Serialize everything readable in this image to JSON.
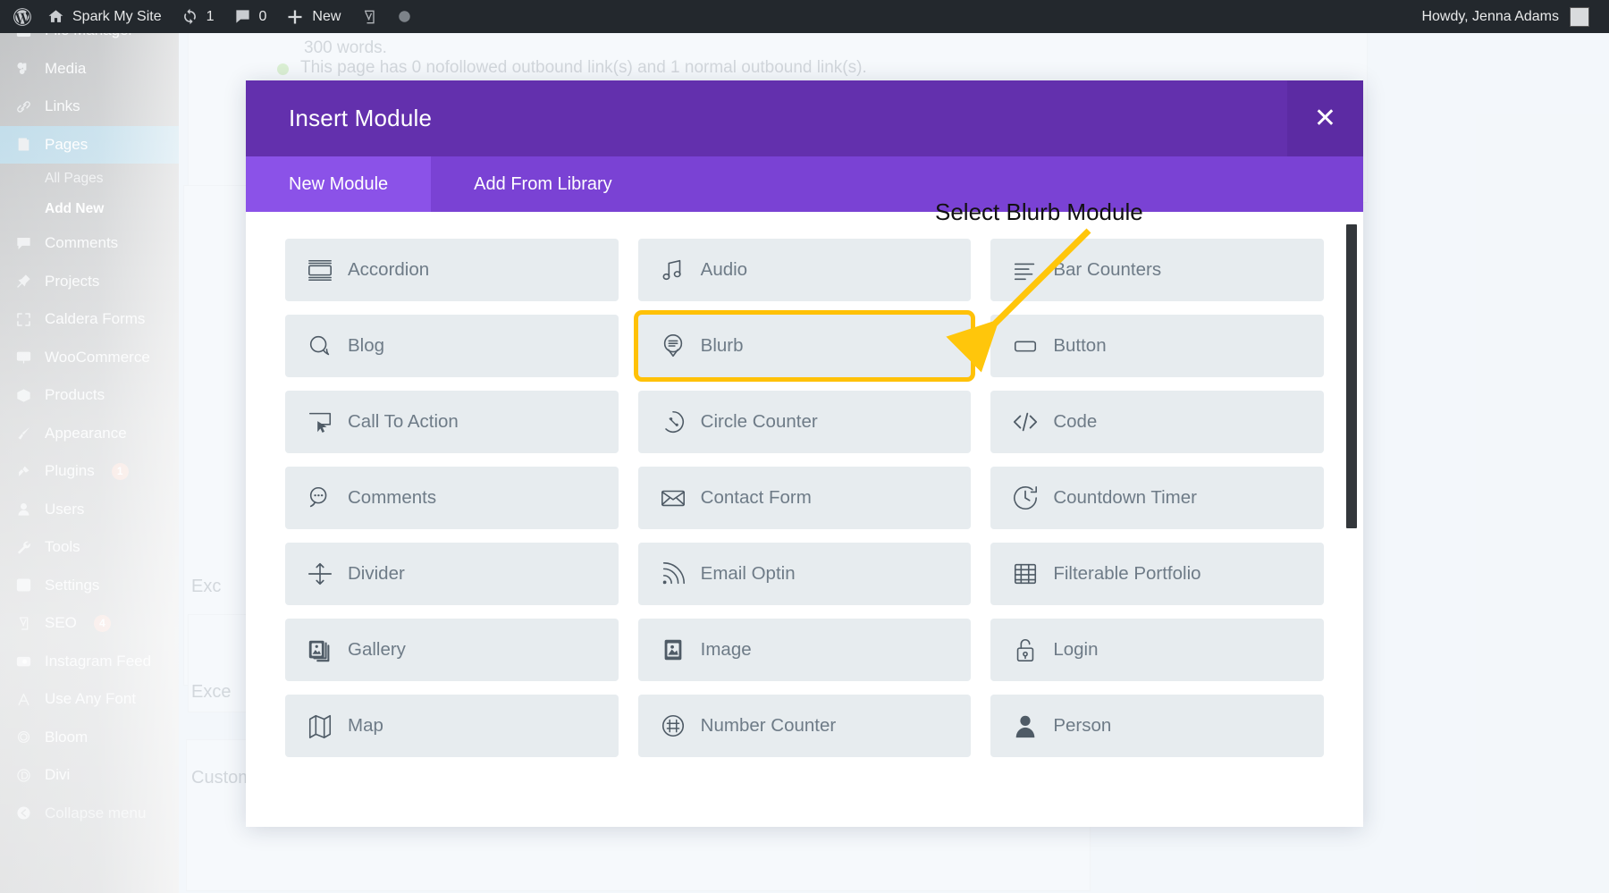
{
  "adminbar": {
    "logo_icon": "wordpress-logo-icon",
    "site_icon": "home-icon",
    "site_name": "Spark My Site",
    "updates_icon": "updates-icon",
    "updates_count": "1",
    "comments_icon": "comment-bubble-icon",
    "comments_count": "0",
    "new_icon": "plus-icon",
    "new_label": "New",
    "yoast_icon": "yoast-seo-icon",
    "status_icon": "gray-circle-icon",
    "howdy": "Howdy, Jenna Adams",
    "avatar_name": "avatar"
  },
  "sidebar": {
    "items": [
      {
        "label": "File Manager",
        "icon": "file-manager-icon",
        "state": "partial"
      },
      {
        "label": "Media",
        "icon": "media-icon",
        "state": "normal"
      },
      {
        "label": "Links",
        "icon": "links-icon",
        "state": "normal"
      },
      {
        "label": "Pages",
        "icon": "pages-icon",
        "state": "current"
      },
      {
        "label": "Comments",
        "icon": "comments-icon",
        "state": "normal"
      },
      {
        "label": "Projects",
        "icon": "projects-pin-icon",
        "state": "normal"
      },
      {
        "label": "Caldera Forms",
        "icon": "caldera-forms-icon",
        "state": "normal"
      },
      {
        "label": "WooCommerce",
        "icon": "woocommerce-icon",
        "state": "normal"
      },
      {
        "label": "Products",
        "icon": "products-box-icon",
        "state": "normal"
      },
      {
        "label": "Appearance",
        "icon": "appearance-brush-icon",
        "state": "normal"
      },
      {
        "label": "Plugins",
        "icon": "plugins-icon",
        "state": "normal",
        "badge": "1"
      },
      {
        "label": "Users",
        "icon": "users-icon",
        "state": "normal"
      },
      {
        "label": "Tools",
        "icon": "tools-wrench-icon",
        "state": "normal"
      },
      {
        "label": "Settings",
        "icon": "settings-icon",
        "state": "normal"
      },
      {
        "label": "SEO",
        "icon": "yoast-seo-icon",
        "state": "normal",
        "badge": "4"
      },
      {
        "label": "Instagram Feed",
        "icon": "instagram-camera-icon",
        "state": "normal"
      },
      {
        "label": "Use Any Font",
        "icon": "letter-a-icon",
        "state": "normal"
      },
      {
        "label": "Bloom",
        "icon": "bloom-icon",
        "state": "normal"
      },
      {
        "label": "Divi",
        "icon": "divi-icon",
        "state": "normal"
      },
      {
        "label": "Collapse menu",
        "icon": "collapse-arrow-icon",
        "state": "collapse"
      }
    ],
    "submenu": [
      {
        "label": "All Pages",
        "active": false
      },
      {
        "label": "Add New",
        "active": true
      }
    ]
  },
  "background": {
    "word_count_text": "300 words.",
    "outbound_links_text": "This page has 0 nofollowed outbound link(s) and 1 normal outbound link(s).",
    "excerpt_label_1": "Exc",
    "excerpt_label_2": "Exce",
    "custom_fields_label": "Custom Fields"
  },
  "modal": {
    "title": "Insert Module",
    "close_icon": "close-x-icon",
    "close_label": "✕",
    "tabs": [
      {
        "label": "New Module",
        "active": true
      },
      {
        "label": "Add From Library",
        "active": false
      }
    ],
    "modules": [
      {
        "label": "Accordion",
        "icon": "accordion-icon",
        "highlight": false
      },
      {
        "label": "Audio",
        "icon": "audio-note-icon",
        "highlight": false
      },
      {
        "label": "Bar Counters",
        "icon": "bar-counters-icon",
        "highlight": false
      },
      {
        "label": "Blog",
        "icon": "blog-bubble-icon",
        "highlight": false
      },
      {
        "label": "Blurb",
        "icon": "blurb-icon",
        "highlight": true
      },
      {
        "label": "Button",
        "icon": "button-icon",
        "highlight": false
      },
      {
        "label": "Call To Action",
        "icon": "call-to-action-icon",
        "highlight": false
      },
      {
        "label": "Circle Counter",
        "icon": "circle-counter-icon",
        "highlight": false
      },
      {
        "label": "Code",
        "icon": "code-brackets-icon",
        "highlight": false
      },
      {
        "label": "Comments",
        "icon": "comments-bubble-icon",
        "highlight": false
      },
      {
        "label": "Contact Form",
        "icon": "envelope-icon",
        "highlight": false
      },
      {
        "label": "Countdown Timer",
        "icon": "countdown-clock-icon",
        "highlight": false
      },
      {
        "label": "Divider",
        "icon": "divider-icon",
        "highlight": false
      },
      {
        "label": "Email Optin",
        "icon": "email-optin-signal-icon",
        "highlight": false
      },
      {
        "label": "Filterable Portfolio",
        "icon": "grid-portfolio-icon",
        "highlight": false
      },
      {
        "label": "Gallery",
        "icon": "gallery-images-icon",
        "highlight": false
      },
      {
        "label": "Image",
        "icon": "image-icon",
        "highlight": false
      },
      {
        "label": "Login",
        "icon": "lock-icon",
        "highlight": false
      },
      {
        "label": "Map",
        "icon": "map-icon",
        "highlight": false
      },
      {
        "label": "Number Counter",
        "icon": "number-hash-icon",
        "highlight": false
      },
      {
        "label": "Person",
        "icon": "person-icon",
        "highlight": false
      }
    ],
    "scrollbar_name": "modal-scrollbar"
  },
  "annotation": {
    "text": "Select Blurb Module",
    "arrow_name": "annotation-arrow",
    "color": "#FFC60B"
  },
  "colors": {
    "modal_header": "#6330AD",
    "modal_tabbar": "#7A42D4",
    "modal_tab_active": "#8B52E8",
    "tile_bg": "#E7ECEF",
    "tile_text": "#6E7B87",
    "highlight": "#FFC107",
    "adminbar": "#23282D",
    "sidebar_current": "#0073AA"
  }
}
